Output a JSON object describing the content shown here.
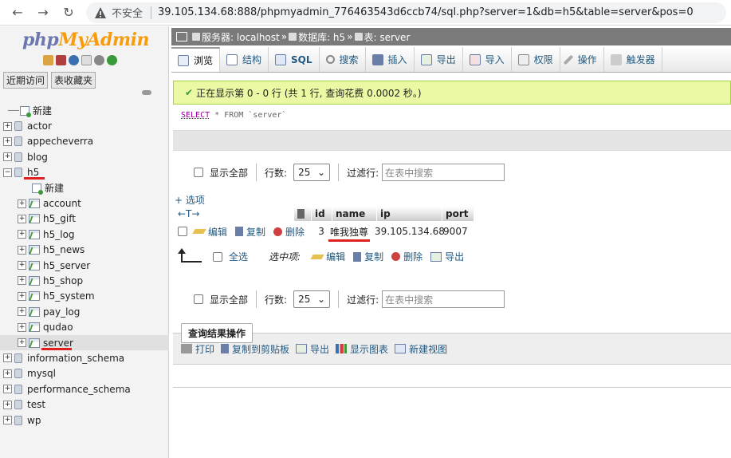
{
  "browser": {
    "insecure": "不安全",
    "url": "39.105.134.68:888/phpmyadmin_776463543d6ccb74/sql.php?server=1&db=h5&table=server&pos=0"
  },
  "logo": {
    "php": "php",
    "my": "MyAdmin"
  },
  "left_buttons": {
    "recent": "近期访问",
    "favorites": "表收藏夹"
  },
  "tree": {
    "new": "新建",
    "databases_top": [
      "actor",
      "appecheverra",
      "blog"
    ],
    "h5": "h5",
    "h5_new": "新建",
    "h5_tables": [
      "account",
      "h5_gift",
      "h5_log",
      "h5_news",
      "h5_server",
      "h5_shop",
      "h5_system",
      "pay_log",
      "qudao",
      "server"
    ],
    "databases_bottom": [
      "information_schema",
      "mysql",
      "performance_schema",
      "test",
      "wp"
    ]
  },
  "breadcrumb": {
    "server": "服务器: localhost",
    "db": "数据库: h5",
    "table": "表: server",
    "sep": "»"
  },
  "tabs": [
    "浏览",
    "结构",
    "SQL",
    "搜索",
    "插入",
    "导出",
    "导入",
    "权限",
    "操作",
    "触发器"
  ],
  "success_message": "正在显示第 0 - 0 行 (共 1 行, 查询花费 0.0002 秒。)",
  "sql": {
    "select": "SELECT",
    "rest": " * FROM `server`"
  },
  "nav": {
    "show_all": "显示全部",
    "rows_label": "行数:",
    "rows_value": "25",
    "filter_label": "过滤行:",
    "filter_placeholder": "在表中搜索"
  },
  "options_link": "+ 选项",
  "table": {
    "headers": [
      "id",
      "name",
      "ip",
      "port"
    ],
    "row": {
      "edit": "编辑",
      "copy": "复制",
      "delete": "删除",
      "id": "3",
      "name": "唯我独尊",
      "ip": "39.105.134.68",
      "port": "9007"
    }
  },
  "with_selected": {
    "select_all": "全选",
    "label": "选中项:",
    "edit": "编辑",
    "copy": "复制",
    "delete": "删除",
    "export": "导出"
  },
  "query_ops": {
    "legend": "查询结果操作",
    "print": "打印",
    "copy_clipboard": "复制到剪贴板",
    "export": "导出",
    "chart": "显示图表",
    "new_view": "新建视图"
  }
}
